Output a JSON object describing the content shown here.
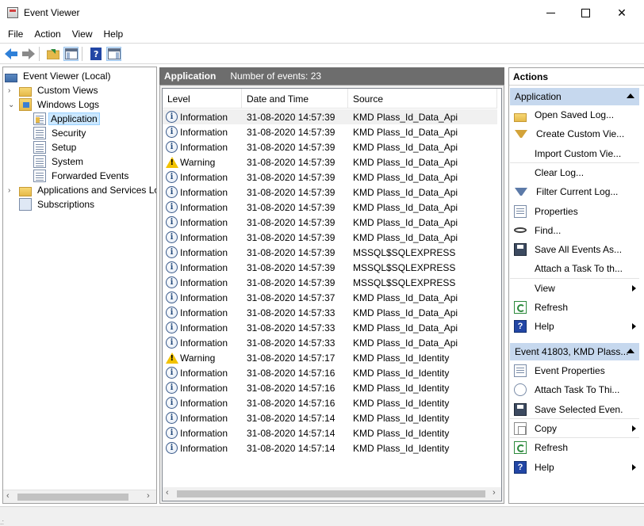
{
  "window": {
    "title": "Event Viewer",
    "minimize_glyph": "",
    "close_glyph": "✕"
  },
  "menu": [
    "File",
    "Action",
    "View",
    "Help"
  ],
  "toolbar": {
    "buttons": [
      "back-arrow-icon",
      "forward-arrow-icon",
      "open-folder-icon",
      "show-hide-tree-icon",
      "help-icon",
      "show-hide-action-pane-icon"
    ]
  },
  "tree": {
    "root": "Event Viewer (Local)",
    "custom_views": "Custom Views",
    "windows_logs": "Windows Logs",
    "application": "Application",
    "security": "Security",
    "setup": "Setup",
    "system": "System",
    "forwarded_events": "Forwarded Events",
    "apps_services": "Applications and Services Lo",
    "subscriptions": "Subscriptions"
  },
  "center": {
    "title": "Application",
    "count_text": "Number of events: 23",
    "columns": {
      "level": "Level",
      "date": "Date and Time",
      "source": "Source"
    },
    "rows": [
      {
        "level": "Information",
        "icon": "info",
        "date": "31-08-2020 14:57:39",
        "source": "KMD Plass_Id_Data_Api"
      },
      {
        "level": "Information",
        "icon": "info",
        "date": "31-08-2020 14:57:39",
        "source": "KMD Plass_Id_Data_Api"
      },
      {
        "level": "Information",
        "icon": "info",
        "date": "31-08-2020 14:57:39",
        "source": "KMD Plass_Id_Data_Api"
      },
      {
        "level": "Warning",
        "icon": "warning",
        "date": "31-08-2020 14:57:39",
        "source": "KMD Plass_Id_Data_Api"
      },
      {
        "level": "Information",
        "icon": "info",
        "date": "31-08-2020 14:57:39",
        "source": "KMD Plass_Id_Data_Api"
      },
      {
        "level": "Information",
        "icon": "info",
        "date": "31-08-2020 14:57:39",
        "source": "KMD Plass_Id_Data_Api"
      },
      {
        "level": "Information",
        "icon": "info",
        "date": "31-08-2020 14:57:39",
        "source": "KMD Plass_Id_Data_Api"
      },
      {
        "level": "Information",
        "icon": "info",
        "date": "31-08-2020 14:57:39",
        "source": "KMD Plass_Id_Data_Api"
      },
      {
        "level": "Information",
        "icon": "info",
        "date": "31-08-2020 14:57:39",
        "source": "KMD Plass_Id_Data_Api"
      },
      {
        "level": "Information",
        "icon": "info",
        "date": "31-08-2020 14:57:39",
        "source": "MSSQL$SQLEXPRESS"
      },
      {
        "level": "Information",
        "icon": "info",
        "date": "31-08-2020 14:57:39",
        "source": "MSSQL$SQLEXPRESS"
      },
      {
        "level": "Information",
        "icon": "info",
        "date": "31-08-2020 14:57:39",
        "source": "MSSQL$SQLEXPRESS"
      },
      {
        "level": "Information",
        "icon": "info",
        "date": "31-08-2020 14:57:37",
        "source": "KMD Plass_Id_Data_Api"
      },
      {
        "level": "Information",
        "icon": "info",
        "date": "31-08-2020 14:57:33",
        "source": "KMD Plass_Id_Data_Api"
      },
      {
        "level": "Information",
        "icon": "info",
        "date": "31-08-2020 14:57:33",
        "source": "KMD Plass_Id_Data_Api"
      },
      {
        "level": "Information",
        "icon": "info",
        "date": "31-08-2020 14:57:33",
        "source": "KMD Plass_Id_Data_Api"
      },
      {
        "level": "Warning",
        "icon": "warning",
        "date": "31-08-2020 14:57:17",
        "source": "KMD Plass_Id_Identity"
      },
      {
        "level": "Information",
        "icon": "info",
        "date": "31-08-2020 14:57:16",
        "source": "KMD Plass_Id_Identity"
      },
      {
        "level": "Information",
        "icon": "info",
        "date": "31-08-2020 14:57:16",
        "source": "KMD Plass_Id_Identity"
      },
      {
        "level": "Information",
        "icon": "info",
        "date": "31-08-2020 14:57:16",
        "source": "KMD Plass_Id_Identity"
      },
      {
        "level": "Information",
        "icon": "info",
        "date": "31-08-2020 14:57:14",
        "source": "KMD Plass_Id_Identity"
      },
      {
        "level": "Information",
        "icon": "info",
        "date": "31-08-2020 14:57:14",
        "source": "KMD Plass_Id_Identity"
      },
      {
        "level": "Information",
        "icon": "info",
        "date": "31-08-2020 14:57:14",
        "source": "KMD Plass_Id_Identity"
      }
    ]
  },
  "actions": {
    "header": "Actions",
    "section1": {
      "title": "Application",
      "items": [
        {
          "label": "Open Saved Log...",
          "icon": "open-folder-icon",
          "submenu": false
        },
        {
          "label": "Create Custom Vie...",
          "icon": "filter-create-icon",
          "submenu": false
        },
        {
          "label": "Import Custom Vie...",
          "icon": "",
          "submenu": false
        },
        {
          "label": "Clear Log...",
          "icon": "",
          "submenu": false
        },
        {
          "label": "Filter Current Log...",
          "icon": "filter-icon",
          "submenu": false
        },
        {
          "label": "Properties",
          "icon": "properties-icon",
          "submenu": false
        },
        {
          "label": "Find...",
          "icon": "find-icon",
          "submenu": false
        },
        {
          "label": "Save All Events As...",
          "icon": "save-icon",
          "submenu": false
        },
        {
          "label": "Attach a Task To th...",
          "icon": "",
          "submenu": false
        },
        {
          "label": "View",
          "icon": "",
          "submenu": true
        },
        {
          "label": "Refresh",
          "icon": "refresh-icon",
          "submenu": false
        },
        {
          "label": "Help",
          "icon": "help-icon",
          "submenu": true
        }
      ]
    },
    "section2": {
      "title": "Event 41803, KMD Plass...",
      "items": [
        {
          "label": "Event Properties",
          "icon": "properties-icon",
          "submenu": false
        },
        {
          "label": "Attach Task To Thi...",
          "icon": "task-icon",
          "submenu": false
        },
        {
          "label": "Save Selected Even...",
          "icon": "save-icon",
          "submenu": false
        },
        {
          "label": "Copy",
          "icon": "copy-icon",
          "submenu": true
        },
        {
          "label": "Refresh",
          "icon": "refresh-icon",
          "submenu": false
        },
        {
          "label": "Help",
          "icon": "help-icon",
          "submenu": true
        }
      ]
    }
  },
  "colors": {
    "section_header_bg": "#c6d8ee",
    "center_header_bg": "#6d6d6d",
    "selection_bg": "#cce8ff"
  }
}
